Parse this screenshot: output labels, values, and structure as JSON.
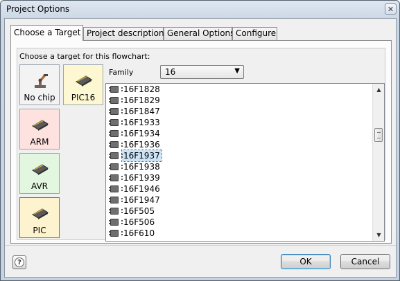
{
  "window": {
    "title": "Project Options",
    "close_glyph": "✕"
  },
  "tabs": [
    {
      "label": "Choose a Target",
      "active": true
    },
    {
      "label": "Project description",
      "active": false
    },
    {
      "label": "General Options",
      "active": false
    },
    {
      "label": "Configure",
      "active": false
    }
  ],
  "target": {
    "prompt": "Choose a target for this flowchart:",
    "chips": {
      "nochip": {
        "label": "No chip",
        "icon": "robot-arm-icon",
        "color": "#f3f3f3"
      },
      "arm": {
        "label": "ARM",
        "icon": "chip-icon",
        "color": "#fde2e0"
      },
      "avr": {
        "label": "AVR",
        "icon": "chip-icon",
        "color": "#e3f6df"
      },
      "pic": {
        "label": "PIC",
        "icon": "chip-icon",
        "color": "#fdf4cf"
      },
      "pic16": {
        "label": "PIC16",
        "icon": "chip-icon",
        "color": "#fdf8d2"
      }
    },
    "family_label": "Family",
    "family_value": "16",
    "devices": [
      "16F1828",
      "16F1829",
      "16F1847",
      "16F1933",
      "16F1934",
      "16F1936",
      "16F1937",
      "16F1938",
      "16F1939",
      "16F1946",
      "16F1947",
      "16F505",
      "16F506",
      "16F610"
    ],
    "selected_device": "16F1937"
  },
  "footer": {
    "help_glyph": "?",
    "ok_label": "OK",
    "cancel_label": "Cancel"
  }
}
